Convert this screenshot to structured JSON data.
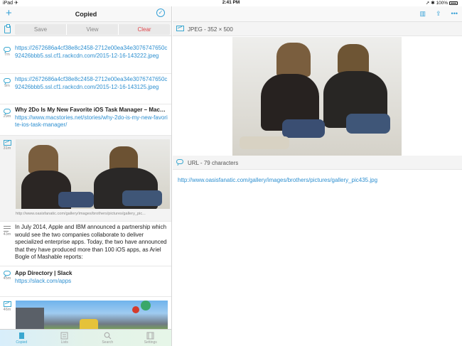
{
  "status_bar": {
    "left": "iPad ✈︎",
    "time": "2:41 PM",
    "battery_pct": "100%"
  },
  "left_header": {
    "title": "Copied",
    "add_icon": "plus-icon",
    "select_icon": "checkmark-circle-icon"
  },
  "segment": {
    "save": "Save",
    "view": "View",
    "clear": "Clear"
  },
  "items": [
    {
      "type": "link",
      "age": "7m",
      "text": "https://2672686a4cf38e8c2458-2712e00ea34e3076747650c92426bbb5.ssl.cf1.rackcdn.com/2015-12-16-143222.jpeg"
    },
    {
      "type": "link",
      "age": "9m",
      "text": "https://2672686a4cf38e8c2458-2712e00ea34e3076747650c92426bbb5.ssl.cf1.rackcdn.com/2015-12-16-143125.jpeg"
    },
    {
      "type": "web",
      "age": "29m",
      "title": "Why 2Do Is My New Favorite iOS Task Manager – Mac…",
      "url": "https://www.macstories.net/stories/why-2do-is-my-new-favorite-ios-task-manager/"
    },
    {
      "type": "image",
      "age": "31m",
      "caption": "http://www.oasisfanatic.com/gallery/images/brothers/pictures/gallery_pic..."
    },
    {
      "type": "text",
      "age": "43m",
      "text": "In July 2014, Apple and IBM announced a partnership which would see the two companies collaborate to deliver specialized enterprise apps. Today, the two have announced that they have produced more than 100 iOS apps, as Ariel Bogle of Mashable reports:"
    },
    {
      "type": "web",
      "age": "45m",
      "title": "App Directory | Slack",
      "url": "https://slack.com/apps"
    },
    {
      "type": "image",
      "age": "46m"
    }
  ],
  "tabs": [
    {
      "label": "Copied",
      "icon": "clipboard-icon",
      "active": true
    },
    {
      "label": "Lists",
      "icon": "list-icon",
      "active": false
    },
    {
      "label": "Search",
      "icon": "search-icon",
      "active": false
    },
    {
      "label": "Settings",
      "icon": "settings-icon",
      "active": false
    }
  ],
  "detail": {
    "image_header": "JPEG - 352 × 500",
    "url_header": "URL - 79 characters",
    "url": "http://www.oasisfanatic.com/gallery/images/brothers/pictures/gallery_pic435.jpg"
  },
  "colors": {
    "accent": "#35a0d6",
    "clear": "#e0474c"
  }
}
